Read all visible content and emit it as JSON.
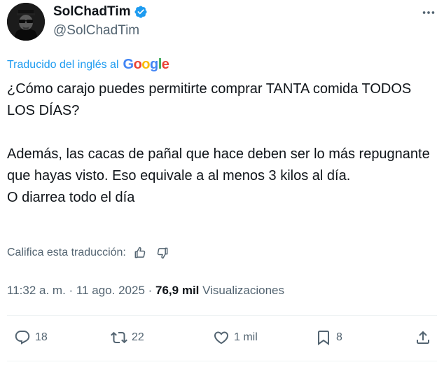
{
  "author": {
    "display_name": "SolChadTim",
    "handle": "@SolChadTim",
    "verified": true
  },
  "translation": {
    "label": "Traducido del inglés al",
    "provider": "Google"
  },
  "tweet": {
    "paragraph1": "¿Cómo carajo puedes permitirte comprar TANTA comida TODOS LOS DÍAS?",
    "paragraph2": "Además, las cacas de pañal que hace deben ser lo más repugnante que hayas visto. Eso equivale a al menos 3 kilos al día.",
    "paragraph3": "O diarrea todo el día"
  },
  "rating": {
    "label": "Califica esta traducción:"
  },
  "meta": {
    "time": "11:32 a. m.",
    "separator1": " · ",
    "date": "11 ago. 2025",
    "separator2": " · ",
    "views_count": "76,9 mil",
    "views_label": " Visualizaciones"
  },
  "actions": {
    "replies": "18",
    "reposts": "22",
    "likes": "1 mil",
    "bookmarks": "8"
  },
  "colors": {
    "accent": "#1d9bf0",
    "text": "#0f1419",
    "muted": "#536471"
  }
}
